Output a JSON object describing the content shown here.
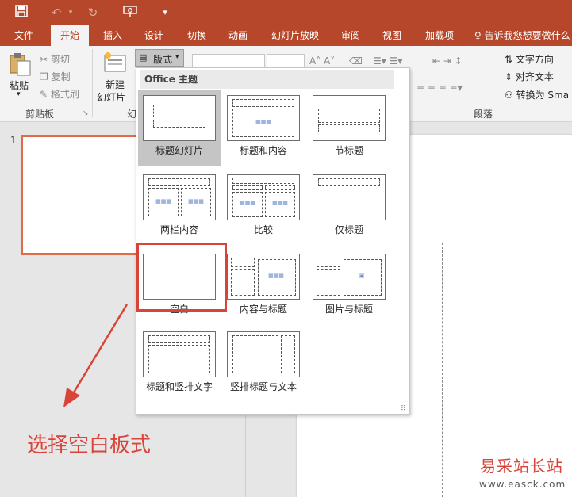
{
  "quick_access": {
    "save_icon": "save-icon",
    "undo_icon": "undo-icon",
    "redo_icon": "redo-icon",
    "present_icon": "present-icon",
    "customize": "▾"
  },
  "tabs": [
    "文件",
    "开始",
    "插入",
    "设计",
    "切换",
    "动画",
    "幻灯片放映",
    "审阅",
    "视图",
    "加载项"
  ],
  "active_tab": "开始",
  "tell_me": "告诉我您想要做什么",
  "ribbon": {
    "clipboard": {
      "paste": "粘贴",
      "cut": "剪切",
      "copy": "复制",
      "format_painter": "格式刷",
      "group": "剪贴板"
    },
    "slides": {
      "new_slide_line1": "新建",
      "new_slide_line2": "幻灯片",
      "layout": "版式",
      "group": "幻"
    },
    "paragraph": {
      "text_direction": "文字方向",
      "align_text": "对齐文本",
      "convert": "转换为 Sma",
      "group": "段落"
    }
  },
  "gallery": {
    "header": "Office 主题",
    "layouts": [
      "标题幻灯片",
      "标题和内容",
      "节标题",
      "两栏内容",
      "比较",
      "仅标题",
      "空白",
      "内容与标题",
      "图片与标题",
      "标题和竖排文字",
      "竖排标题与文本"
    ],
    "selected": "标题幻灯片",
    "highlighted": "空白"
  },
  "slide_pane": {
    "slide_number": "1"
  },
  "annotation": {
    "caption": "选择空白板式"
  },
  "watermark": {
    "site_name": "易采站长站",
    "url": "www.easck.com"
  }
}
